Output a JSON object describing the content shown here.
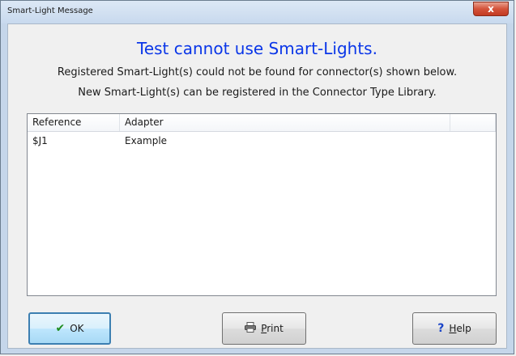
{
  "window": {
    "title": "Smart-Light Message",
    "close_glyph": "x"
  },
  "message": {
    "heading": "Test cannot use Smart-Lights.",
    "line1": "Registered Smart-Light(s) could not be found for connector(s) shown below.",
    "line2": "New Smart-Light(s) can be registered in the Connector Type Library."
  },
  "list": {
    "columns": [
      "Reference",
      "Adapter",
      ""
    ],
    "rows": [
      {
        "reference": "$J1",
        "adapter": "Example"
      }
    ]
  },
  "buttons": {
    "ok": {
      "label": "OK",
      "icon": "check-icon"
    },
    "print": {
      "label": "Print",
      "icon": "printer-icon"
    },
    "help": {
      "label": "Help",
      "icon": "help-icon"
    }
  },
  "colors": {
    "heading": "#0a36e8",
    "accent": "#3c7fb1"
  }
}
